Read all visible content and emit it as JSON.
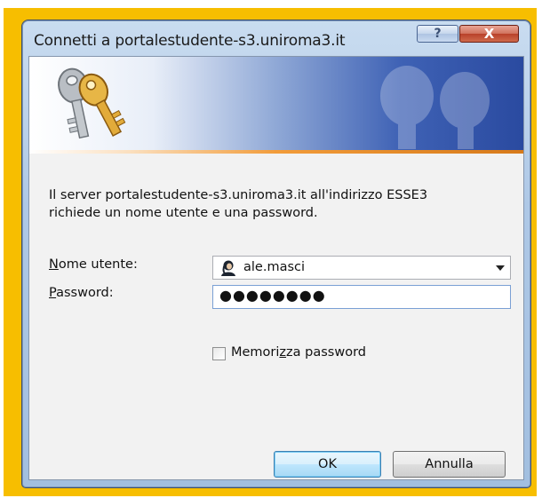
{
  "dialog": {
    "title": "Connetti a portalestudente-s3.uniroma3.it",
    "help_label": "?",
    "close_label": "X"
  },
  "banner": {
    "icon": "keys-icon"
  },
  "message": {
    "line1": "Il server portalestudente-s3.uniroma3.it all'indirizzo ESSE3",
    "line2": "richiede un nome utente e una password."
  },
  "form": {
    "username_label_mnemonic": "N",
    "username_label_rest": "ome utente:",
    "username_value": "ale.masci",
    "password_label_mnemonic": "P",
    "password_label_rest": "assword:",
    "password_value": "●●●●●●●●",
    "remember_label_pre": "Memori",
    "remember_label_mnemonic": "z",
    "remember_label_post": "za password",
    "remember_checked": false
  },
  "buttons": {
    "ok_label": "OK",
    "cancel_label": "Annulla"
  },
  "colors": {
    "backdrop": "#f7be00",
    "banner_accent": "#f29c3a",
    "ok_border": "#3c7fb1"
  }
}
